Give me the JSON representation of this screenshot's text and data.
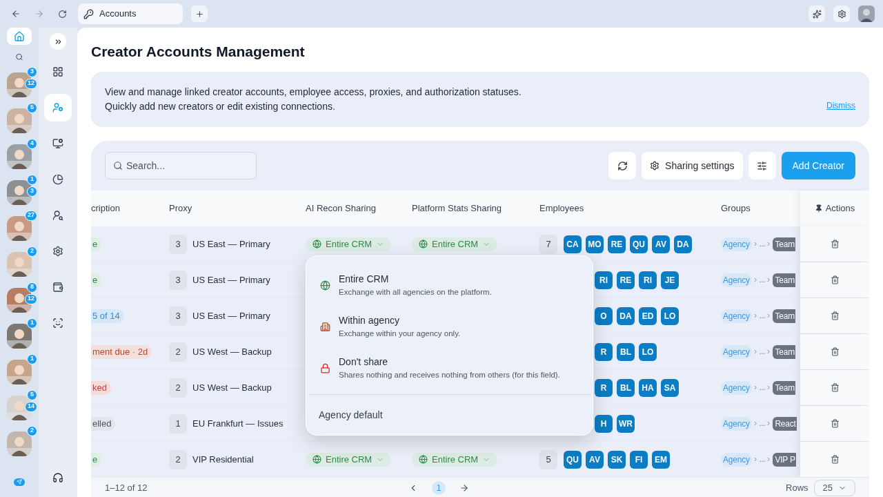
{
  "browser": {
    "tab_title": "Accounts"
  },
  "rail": {
    "home_selected": true,
    "avatars": [
      {
        "badges": [
          "3",
          "12"
        ]
      },
      {
        "badges": [
          "5"
        ]
      },
      {
        "badges": [
          "4"
        ]
      },
      {
        "badges": [
          "1",
          "3"
        ]
      },
      {
        "badges": [
          "27"
        ]
      },
      {
        "badges": [
          "2"
        ]
      },
      {
        "badges": [
          "8",
          "12"
        ]
      },
      {
        "badges": [
          "1"
        ]
      },
      {
        "badges": [
          "1"
        ]
      },
      {
        "badges": [
          "5",
          "14"
        ]
      },
      {
        "badges": [
          "2"
        ]
      }
    ]
  },
  "nav": [
    {
      "selected": false
    },
    {
      "selected": true
    },
    {
      "selected": false
    },
    {
      "selected": false
    },
    {
      "selected": false
    },
    {
      "selected": false
    },
    {
      "selected": false
    },
    {
      "selected": false
    }
  ],
  "page": {
    "title": "Creator Accounts Management",
    "info": {
      "lines": [
        "View and manage linked creator accounts, employee access, proxies, and authorization statuses.",
        "Quickly add new creators or edit existing connections."
      ],
      "dismiss": "Dismiss"
    }
  },
  "toolbar": {
    "search_placeholder": "Search...",
    "sharing_settings": "Sharing settings",
    "add_creator": "Add Creator"
  },
  "table": {
    "columns": [
      "cription",
      "Proxy",
      "AI Recon Sharing",
      "Platform Stats Sharing",
      "Employees",
      "Groups",
      "Actions"
    ],
    "rows": [
      {
        "subscription": {
          "text": "e",
          "kind": "active"
        },
        "proxy_count": "3",
        "proxy": "US East — Primary",
        "ai_recon": {
          "label": "Entire CRM",
          "kind": "entire"
        },
        "platform_stats": {
          "label": "Entire CRM",
          "kind": "entire"
        },
        "employee_count": "7",
        "employees": [
          "CA",
          "MO",
          "RE",
          "QU",
          "AV",
          "DA"
        ],
        "group": "Agency",
        "path_gap": "...",
        "subgroup": "Team"
      },
      {
        "subscription": {
          "text": "e",
          "kind": "active"
        },
        "proxy_count": "3",
        "proxy": "US East — Primary",
        "employees": [
          "RI",
          "RE",
          "RI",
          "JE"
        ],
        "group": "Agency",
        "path_gap": "...",
        "subgroup": "Team"
      },
      {
        "subscription": {
          "text": "5 of 14",
          "kind": "trial"
        },
        "proxy_count": "3",
        "proxy": "US East — Primary",
        "employees": [
          "O",
          "DA",
          "ED",
          "LO"
        ],
        "group": "Agency",
        "path_gap": "...",
        "subgroup": "Team"
      },
      {
        "subscription": {
          "text": "ment due · 2d",
          "kind": "due"
        },
        "proxy_count": "2",
        "proxy": "US West — Backup",
        "employees": [
          "R",
          "BL",
          "LO"
        ],
        "group": "Agency",
        "path_gap": "...",
        "subgroup": "Team"
      },
      {
        "subscription": {
          "text": "ked",
          "kind": "blocked"
        },
        "proxy_count": "2",
        "proxy": "US West — Backup",
        "employees": [
          "R",
          "BL",
          "HA",
          "SA"
        ],
        "group": "Agency",
        "path_gap": "...",
        "subgroup": "Team"
      },
      {
        "subscription": {
          "text": "elled",
          "kind": "cancelled"
        },
        "proxy_count": "1",
        "proxy": "EU Frankfurt — Issues",
        "employees": [
          "H",
          "WR"
        ],
        "group": "Agency",
        "path_gap": "...",
        "subgroup": "React"
      },
      {
        "subscription": {
          "text": "e",
          "kind": "active"
        },
        "proxy_count": "2",
        "proxy": "VIP Residential",
        "ai_recon": {
          "label": "Entire CRM",
          "kind": "entire"
        },
        "platform_stats": {
          "label": "Entire CRM",
          "kind": "entire"
        },
        "employee_count": "5",
        "employees": [
          "QU",
          "AV",
          "SK",
          "FI",
          "EM"
        ],
        "group": "Agency",
        "path_gap": "...",
        "subgroup": "VIP P"
      }
    ]
  },
  "sharing_menu": {
    "options": [
      {
        "kind": "entire",
        "title": "Entire CRM",
        "description": "Exchange with all agencies on the platform."
      },
      {
        "kind": "agency",
        "title": "Within agency",
        "description": "Exchange within your agency only."
      },
      {
        "kind": "none",
        "title": "Don't share",
        "description": "Shares nothing and receives nothing from others (for this field)."
      }
    ],
    "footer": "Agency default"
  },
  "footer": {
    "range": "1–12 of 12",
    "page": "1",
    "rows_label": "Rows",
    "rows_value": "25"
  }
}
